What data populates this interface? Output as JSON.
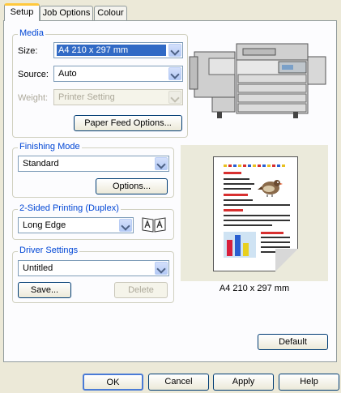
{
  "tabs": [
    {
      "label": "Setup",
      "active": true
    },
    {
      "label": "Job Options",
      "active": false
    },
    {
      "label": "Colour",
      "active": false
    }
  ],
  "media": {
    "legend": "Media",
    "size_label": "Size:",
    "size_value": "A4 210 x 297 mm",
    "source_label": "Source:",
    "source_value": "Auto",
    "weight_label": "Weight:",
    "weight_value": "Printer Setting",
    "paper_feed_button": "Paper Feed Options..."
  },
  "finishing": {
    "legend": "Finishing Mode",
    "value": "Standard",
    "options_button": "Options..."
  },
  "duplex": {
    "legend": "2-Sided Printing (Duplex)",
    "value": "Long Edge"
  },
  "driver": {
    "legend": "Driver Settings",
    "value": "Untitled",
    "save_button": "Save...",
    "delete_button": "Delete"
  },
  "preview": {
    "caption": "A4 210 x 297 mm"
  },
  "default_button": "Default",
  "footer": {
    "ok": "OK",
    "cancel": "Cancel",
    "apply": "Apply",
    "help": "Help"
  },
  "colors": {
    "tab_highlight": "#ffc83c",
    "group_legend": "#0046d5",
    "selection": "#316ac5",
    "dialog_bg": "#ece9d8"
  }
}
